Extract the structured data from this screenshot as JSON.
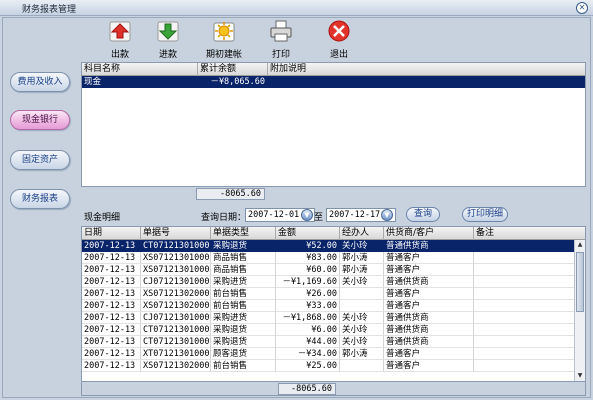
{
  "window": {
    "title": "财务报表管理"
  },
  "toolbar": [
    {
      "label": "出款",
      "icon": "arrow-up-icon"
    },
    {
      "label": "进款",
      "icon": "arrow-down-icon"
    },
    {
      "label": "期初建帐",
      "icon": "sun-icon"
    },
    {
      "label": "打印",
      "icon": "printer-icon"
    },
    {
      "label": "退出",
      "icon": "close-circle-icon"
    }
  ],
  "sidebar": [
    {
      "label": "费用及收入"
    },
    {
      "label": "现金银行"
    },
    {
      "label": "固定资产"
    },
    {
      "label": "财务报表"
    }
  ],
  "accounts": {
    "columns": [
      "科目名称",
      "累计余额",
      "附加说明"
    ],
    "rows": [
      [
        "现金",
        "－¥8,065.60",
        ""
      ]
    ],
    "total": "-8065.60"
  },
  "cash_detail": {
    "label": "现金明细",
    "query_label": "查询日期：",
    "date_from": "2007-12-01",
    "to_label": "至",
    "date_to": "2007-12-17",
    "query_button": "查询",
    "print_button": "打印明细",
    "columns": [
      "日期",
      "单据号",
      "单据类型",
      "金额",
      "经办人",
      "供货商/客户",
      "备注"
    ],
    "rows": [
      [
        "2007-12-13",
        "CT071213010003",
        "采购退货",
        "¥52.00",
        "关小玲",
        "普通供货商",
        ""
      ],
      [
        "2007-12-13",
        "XS071213010001",
        "商品销售",
        "¥83.00",
        "郭小涛",
        "普通客户",
        ""
      ],
      [
        "2007-12-13",
        "XS071213010002",
        "商品销售",
        "¥60.00",
        "郭小涛",
        "普通客户",
        ""
      ],
      [
        "2007-12-13",
        "CJ071213010001",
        "采购进货",
        "－¥1,169.60",
        "关小玲",
        "普通供货商",
        ""
      ],
      [
        "2007-12-13",
        "XS071213020002",
        "前台销售",
        "¥26.00",
        "",
        "普通客户",
        ""
      ],
      [
        "2007-12-13",
        "XS071213020003",
        "前台销售",
        "¥33.00",
        "",
        "普通客户",
        ""
      ],
      [
        "2007-12-13",
        "CJ071213010006",
        "采购进货",
        "－¥1,868.00",
        "关小玲",
        "普通供货商",
        ""
      ],
      [
        "2007-12-13",
        "CT071213010001",
        "采购退货",
        "¥6.00",
        "关小玲",
        "普通供货商",
        ""
      ],
      [
        "2007-12-13",
        "CT071213010002",
        "采购退货",
        "¥44.00",
        "关小玲",
        "普通供货商",
        ""
      ],
      [
        "2007-12-13",
        "XT071213010003",
        "顾客退货",
        "－¥34.00",
        "郭小涛",
        "普通客户",
        ""
      ],
      [
        "2007-12-13",
        "XS071213020001",
        "前台销售",
        "¥25.00",
        "",
        "普通客户",
        ""
      ]
    ],
    "total": "-8065.60"
  }
}
